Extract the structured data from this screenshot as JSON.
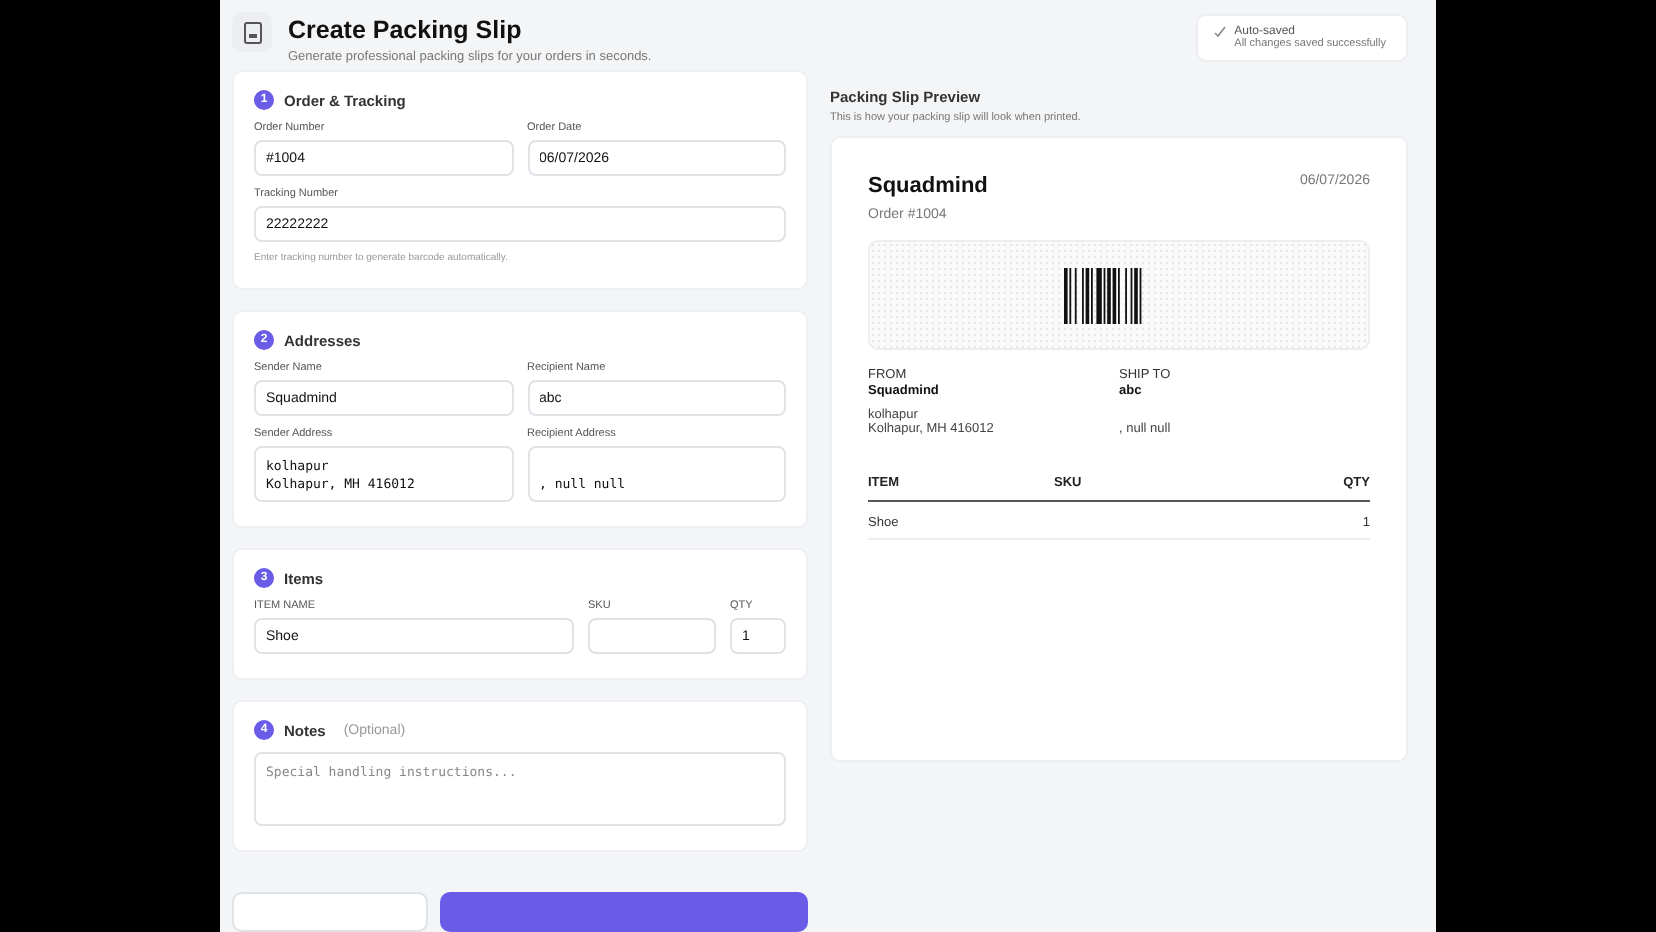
{
  "header": {
    "title": "Create Packing Slip",
    "subtitle": "Generate professional packing slips for your orders in seconds."
  },
  "autosave": {
    "title": "Auto-saved",
    "message": "All changes saved successfully"
  },
  "sections": [
    {
      "number": "1",
      "title": "Order & Tracking",
      "kind": "order",
      "fields": [
        {
          "label": "Order Number",
          "kind": "input",
          "value": "#1004"
        },
        {
          "label": "Order Date",
          "kind": "input",
          "value": "06/07/2026"
        },
        {
          "label": "Tracking Number",
          "kind": "input",
          "value": "22222222"
        }
      ],
      "hint": "Enter tracking number to generate barcode automatically."
    },
    {
      "number": "2",
      "title": "Addresses",
      "kind": "pairs",
      "fields": [
        {
          "label": "Sender Name",
          "kind": "input",
          "value": "Squadmind"
        },
        {
          "label": "Recipient Name",
          "kind": "input",
          "value": "abc"
        },
        {
          "label": "Sender Address",
          "kind": "textarea",
          "value": "kolhapur\nKolhapur, MH 416012"
        },
        {
          "label": "Recipient Address",
          "kind": "textarea",
          "value": "\n, null null"
        }
      ]
    },
    {
      "number": "3",
      "title": "Items",
      "kind": "items",
      "fields": [
        {
          "label": "ITEM NAME",
          "kind": "input",
          "value": "Shoe"
        },
        {
          "label": "SKU",
          "kind": "input"
        },
        {
          "label": "QTY",
          "kind": "input",
          "value": "1"
        }
      ]
    },
    {
      "number": "4",
      "title": "Notes",
      "note": "(Optional)",
      "kind": "single",
      "fields": [
        {
          "kind": "textarea",
          "placeholder": "Special handling instructions..."
        }
      ]
    }
  ],
  "footer_buttons": [
    {
      "kind": "secondary"
    },
    {
      "kind": "primary"
    }
  ],
  "preview": {
    "title": "Packing Slip Preview",
    "subtitle": "This is how your packing slip will look when printed.",
    "company": "Squadmind",
    "order": "Order #1004",
    "date": "06/07/2026",
    "from": {
      "label": "FROM",
      "name": "Squadmind",
      "lines": [
        "kolhapur",
        "Kolhapur, MH 416012"
      ]
    },
    "ship_to": {
      "label": "SHIP TO",
      "name": "abc",
      "lines": [
        ", null null"
      ]
    },
    "columns": [
      "ITEM",
      "SKU",
      "QTY"
    ],
    "rows": [
      [
        "Shoe",
        "",
        "1"
      ]
    ]
  }
}
